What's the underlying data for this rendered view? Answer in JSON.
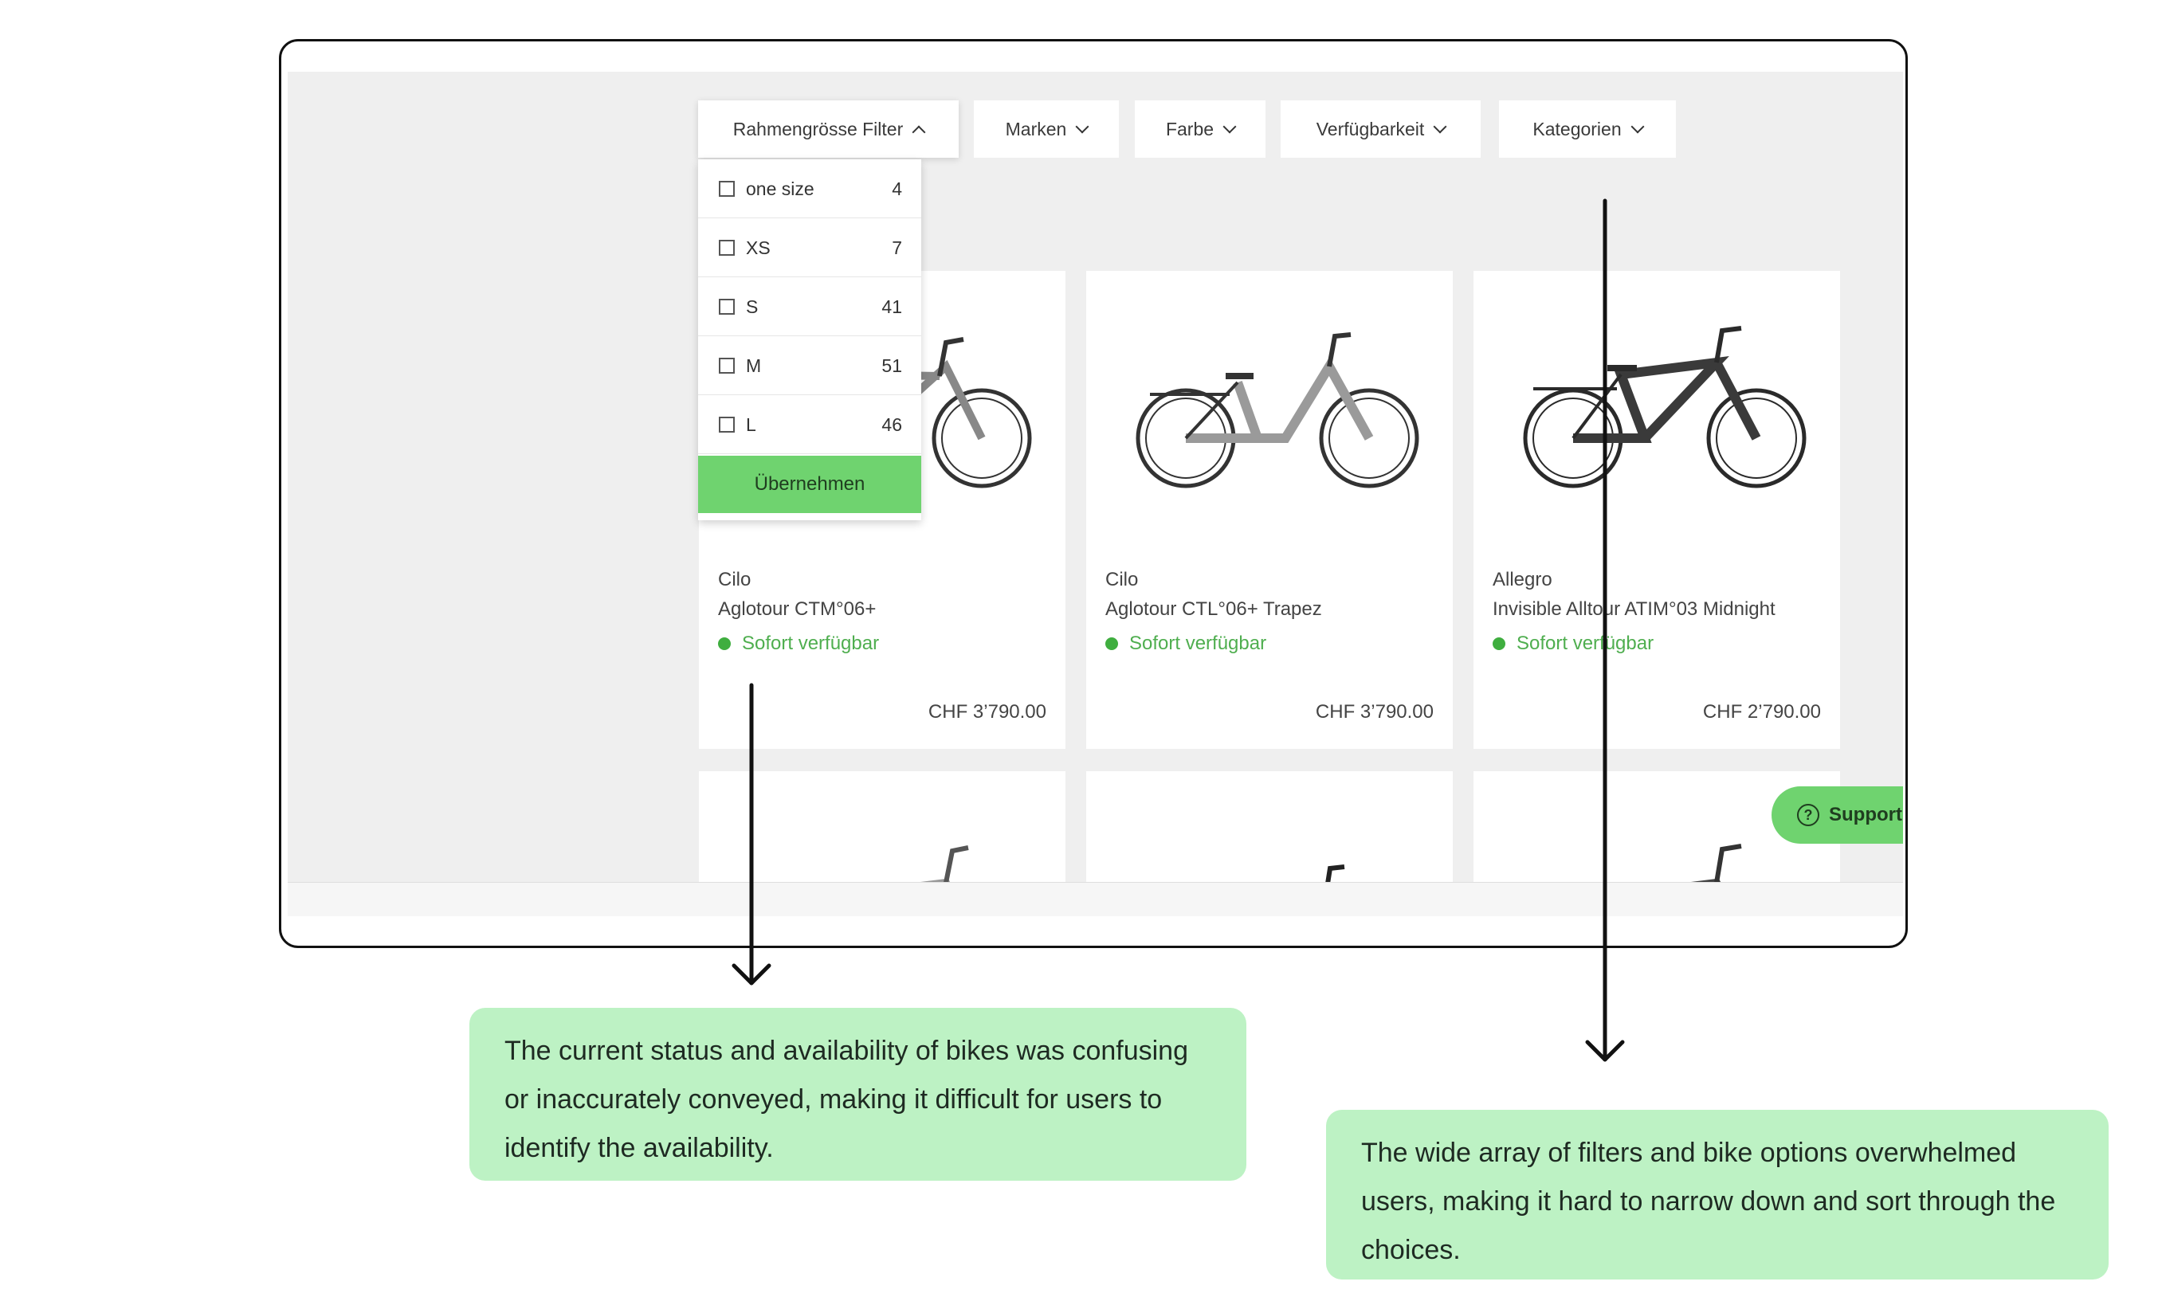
{
  "filters": {
    "frame_size": "Rahmengrösse Filter",
    "brands": "Marken",
    "color": "Farbe",
    "availability": "Verfügbarkeit",
    "categories": "Kategorien"
  },
  "size_dropdown": {
    "options": [
      {
        "label": "one size",
        "count": "4"
      },
      {
        "label": "XS",
        "count": "7"
      },
      {
        "label": "S",
        "count": "41"
      },
      {
        "label": "M",
        "count": "51"
      },
      {
        "label": "L",
        "count": "46"
      }
    ],
    "apply_label": "Übernehmen"
  },
  "products": [
    {
      "brand": "Cilo",
      "model": "Aglotour CTM°06+",
      "availability": "Sofort verfügbar",
      "price": "CHF 3’790.00"
    },
    {
      "brand": "Cilo",
      "model": "Aglotour CTL°06+ Trapez",
      "availability": "Sofort verfügbar",
      "price": "CHF 3’790.00"
    },
    {
      "brand": "Allegro",
      "model": "Invisible Alltour ATIM°03 Midnight",
      "availability": "Sofort verfügbar",
      "price": "CHF 2’790.00"
    }
  ],
  "support_label": "Support",
  "annotations": {
    "availability_note": [
      "The current status and availability of bikes was confusing",
      "or inaccurately conveyed, making it difficult for users to",
      "identify the availability."
    ],
    "filters_note": [
      "The wide array of filters and bike options overwhelmed",
      "users, making it hard to narrow down and sort through the",
      "choices."
    ]
  },
  "colors": {
    "accent_green": "#6fd36f",
    "note_background": "#bdf2c4",
    "availability_green": "#3fae3f"
  }
}
